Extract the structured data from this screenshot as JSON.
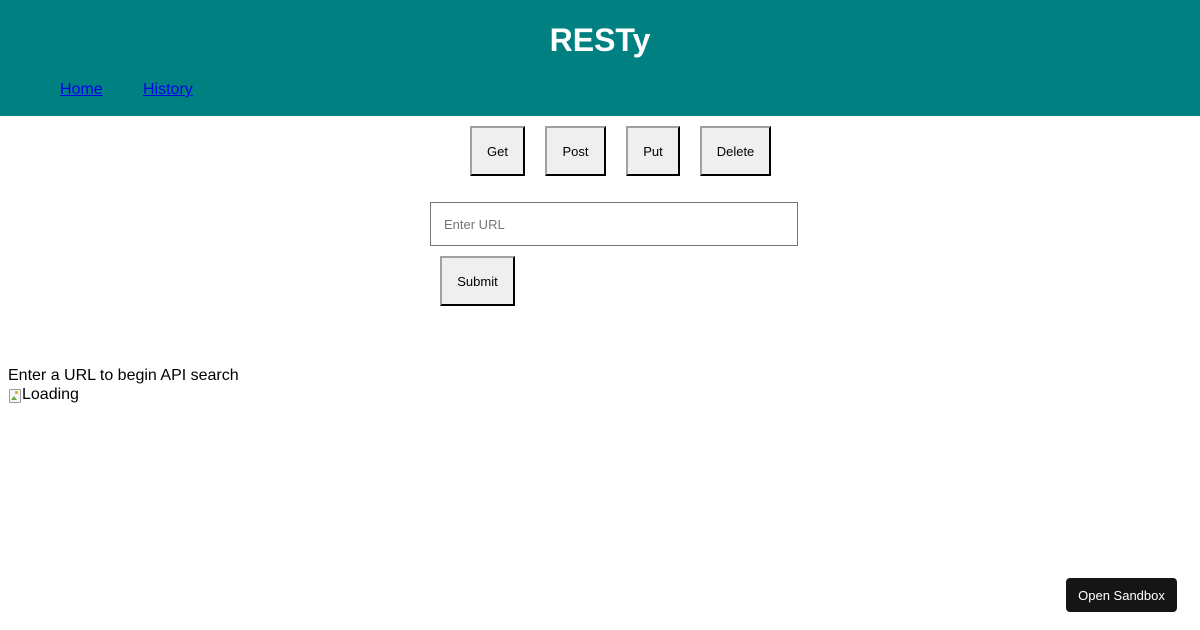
{
  "header": {
    "title": "RESTy",
    "background": "#008080",
    "nav": [
      {
        "label": "Home"
      },
      {
        "label": "History"
      }
    ]
  },
  "methods": [
    {
      "label": "Get"
    },
    {
      "label": "Post"
    },
    {
      "label": "Put"
    },
    {
      "label": "Delete"
    }
  ],
  "form": {
    "url_value": "",
    "url_placeholder": "Enter URL",
    "submit_label": "Submit"
  },
  "results": {
    "status_text": "Enter a URL to begin API search",
    "loading_alt": "Loading"
  },
  "sandbox": {
    "label": "Open Sandbox"
  }
}
